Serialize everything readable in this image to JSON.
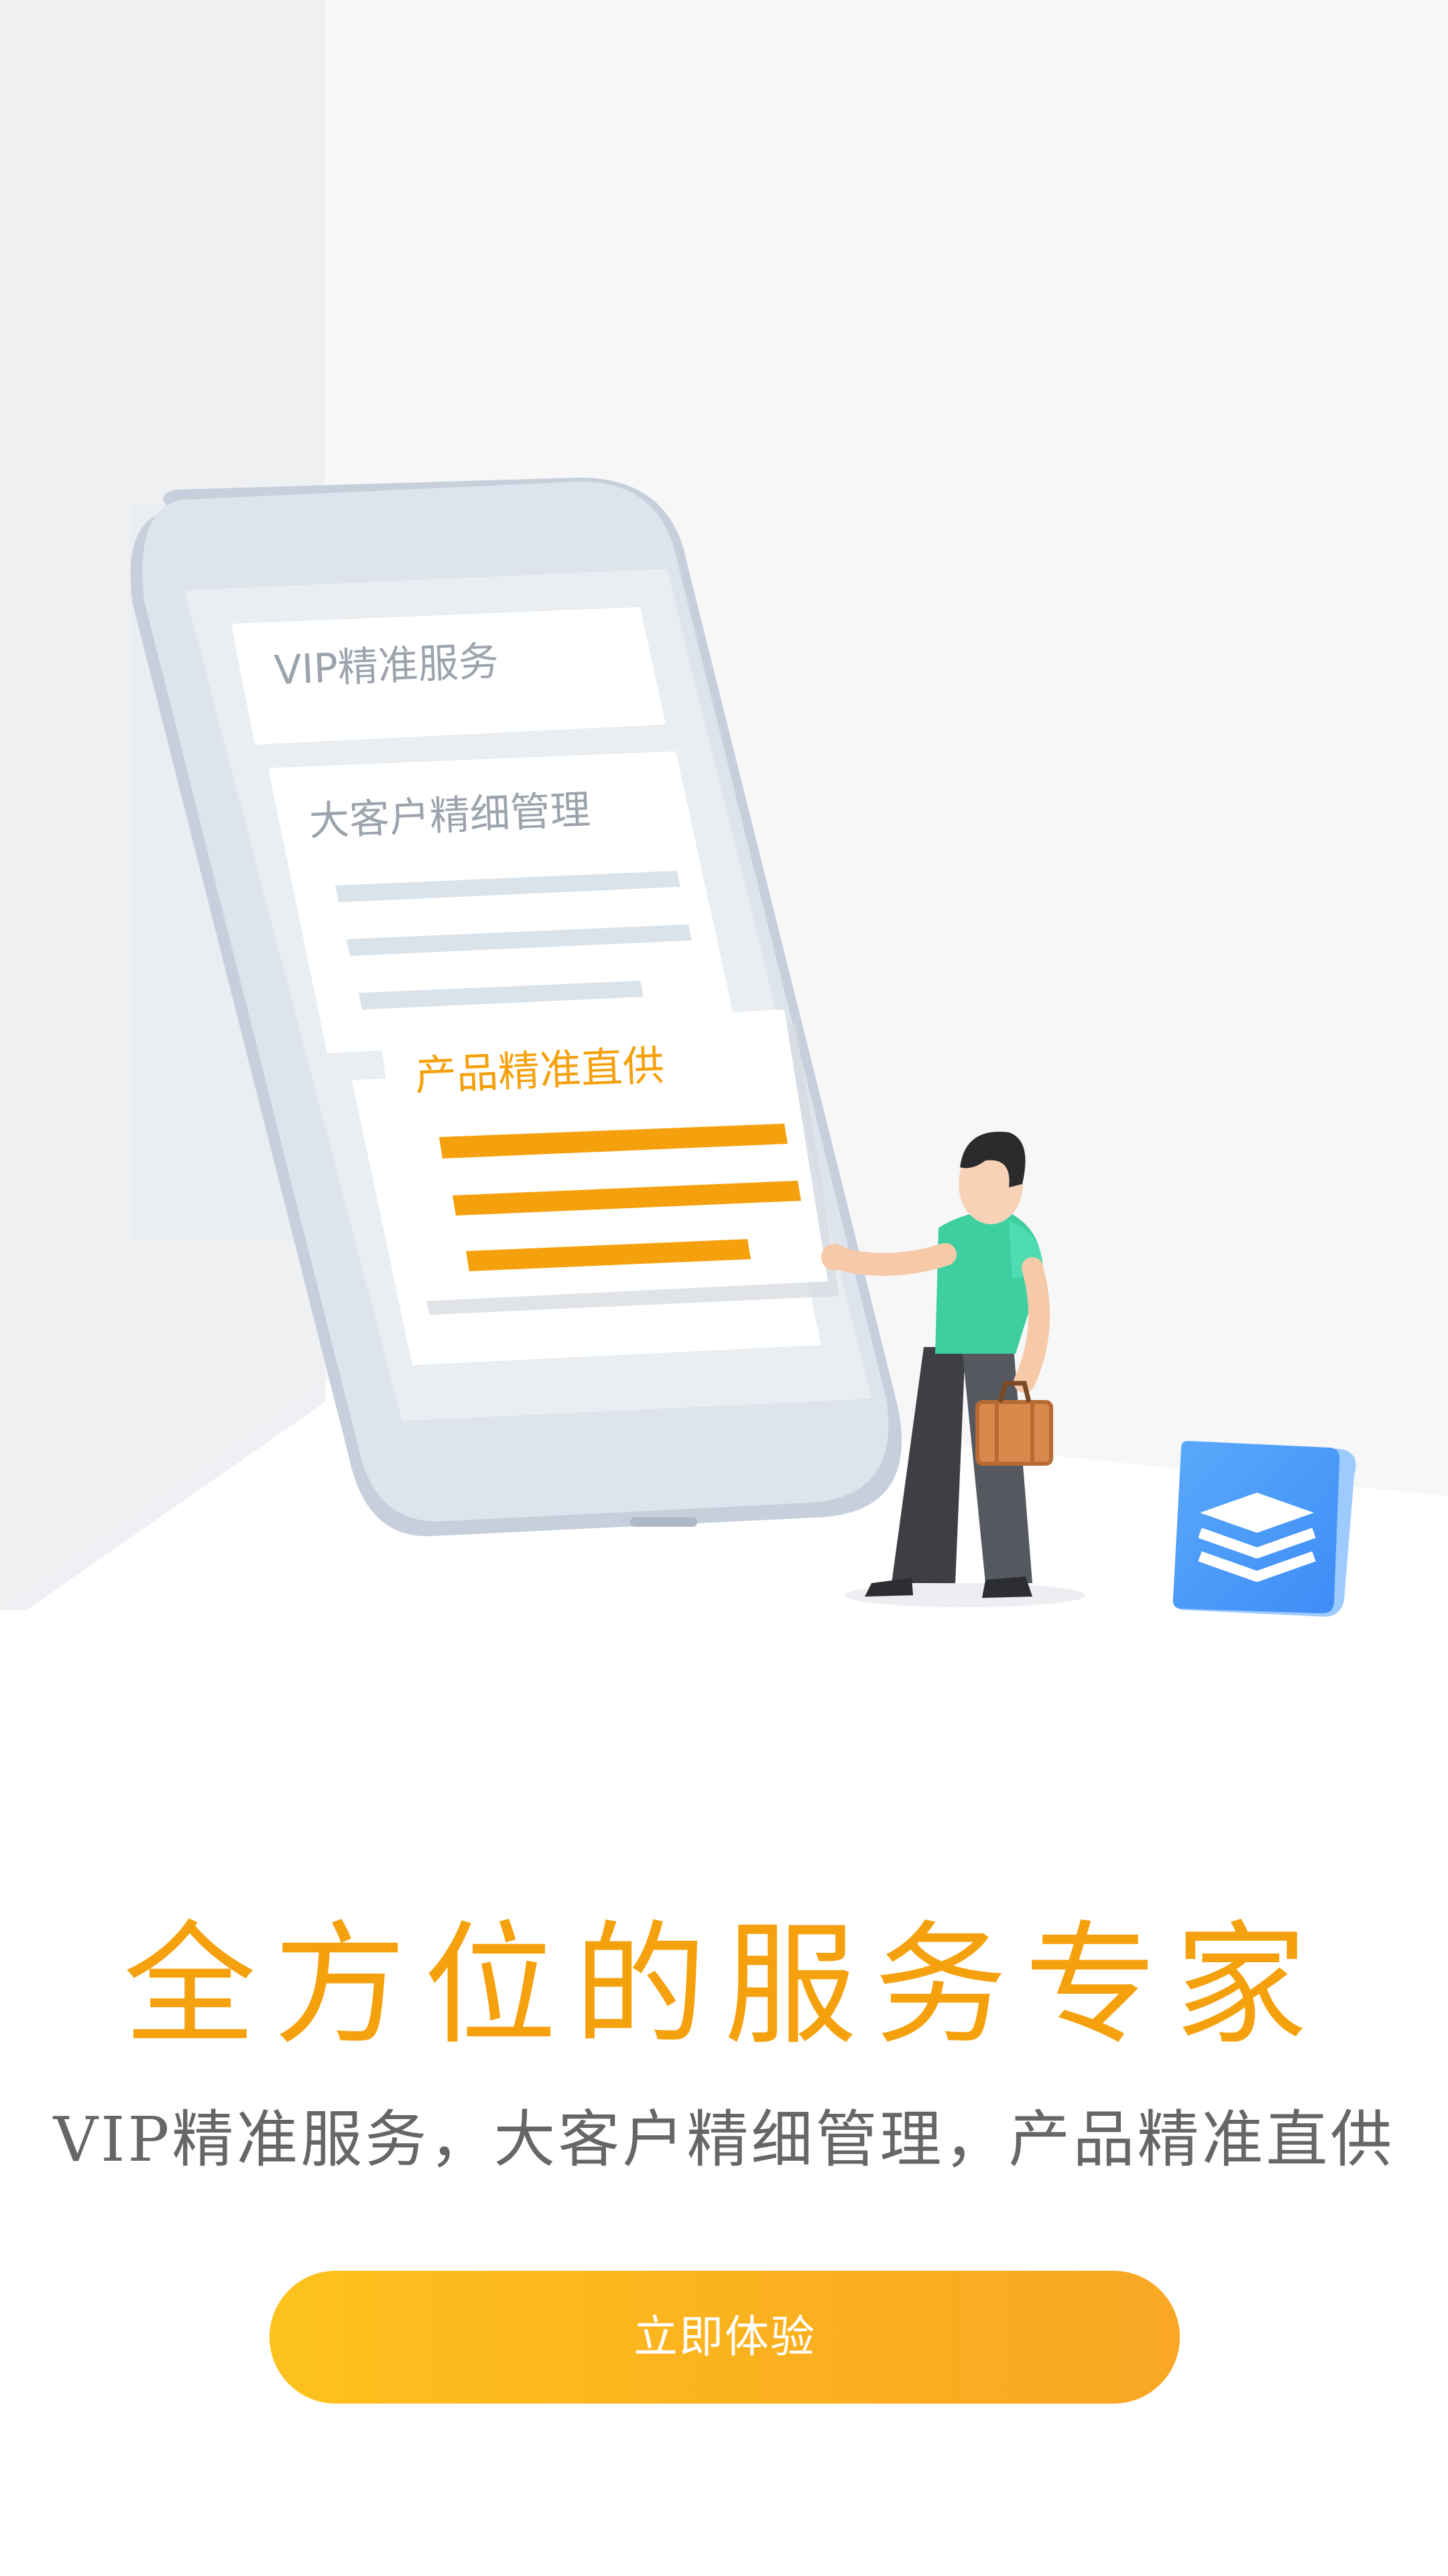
{
  "illustration": {
    "card_vip_label": "VIP精准服务",
    "card_bigclient_label": "大客户精细管理",
    "card_product_label": "产品精准直供",
    "badge_icon": "layers-icon"
  },
  "headline": "全方位的服务专家",
  "subhead": "VIP精准服务，大客户精细管理，产品精准直供",
  "cta_label": "立即体验",
  "colors": {
    "accent": "#f5a10e",
    "cta_start": "#fdc21d",
    "cta_end": "#f9a724",
    "person_shirt": "#3ecfa0",
    "badge": "#4a9ef8"
  }
}
